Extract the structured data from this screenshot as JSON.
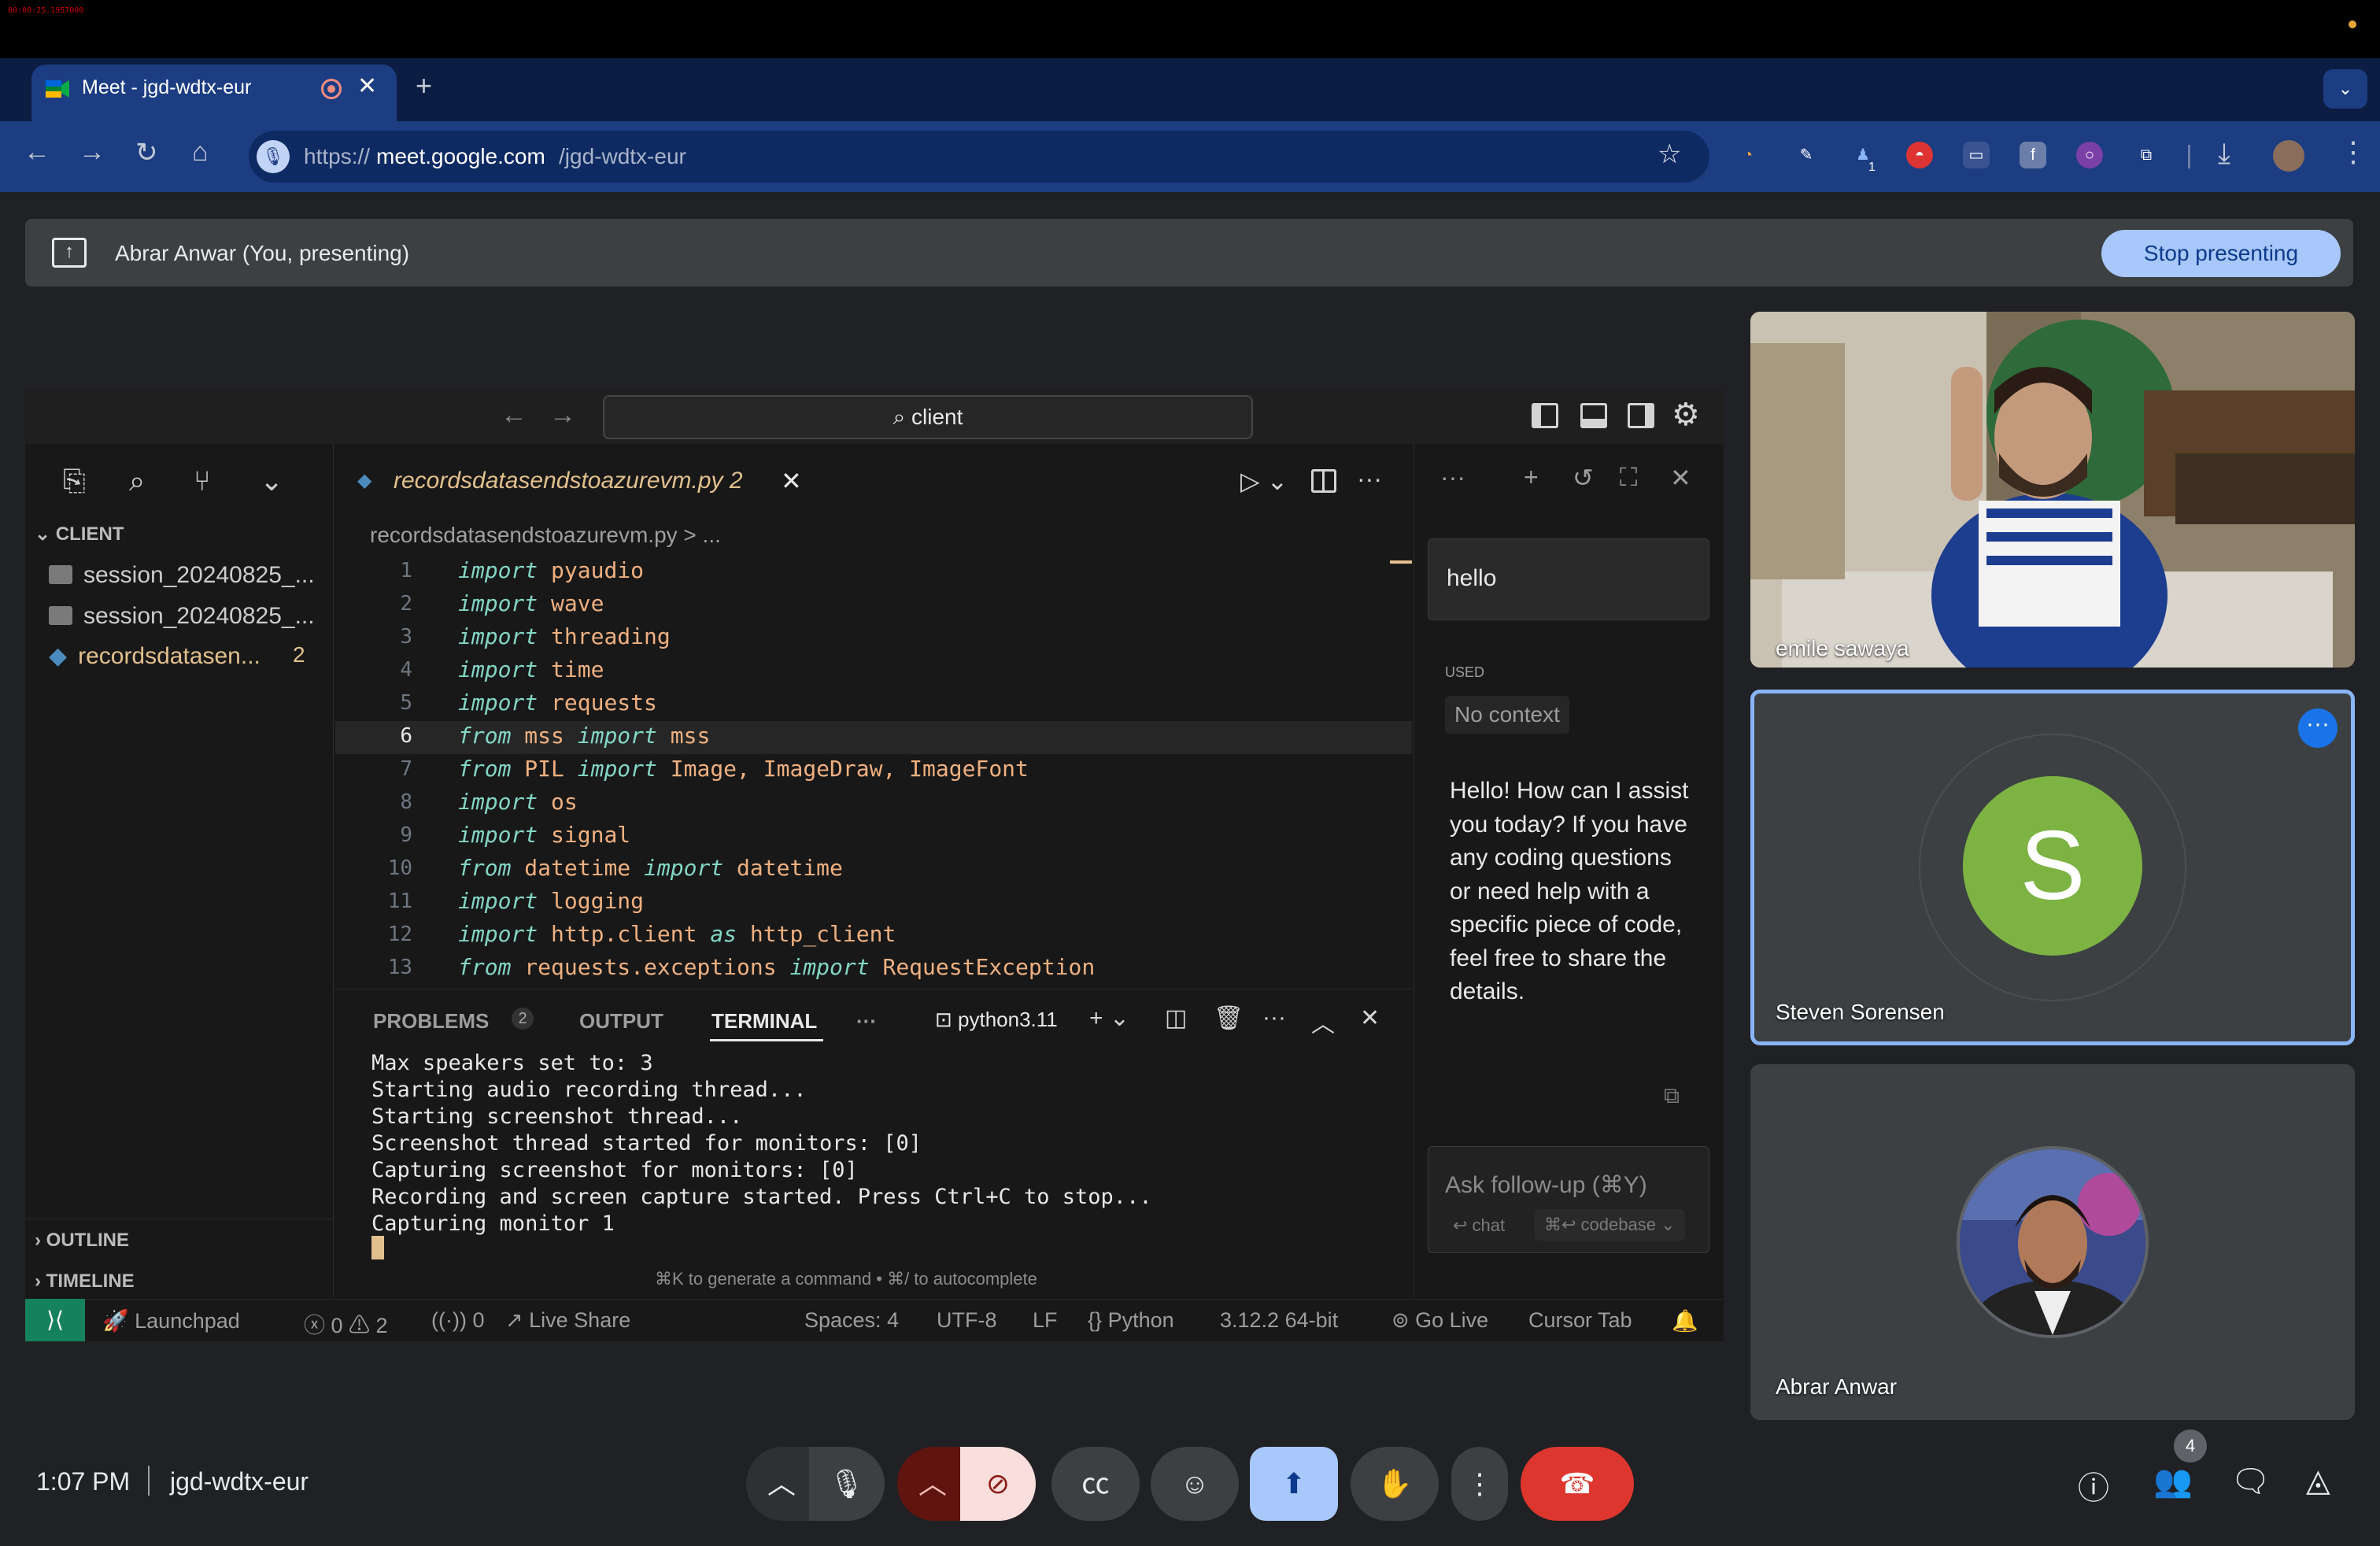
{
  "recording_indicator": "00:00:25.1957000",
  "browser": {
    "tab_title": "Meet - jgd-wdtx-eur",
    "tab_close": "✕",
    "new_tab": "+",
    "tab_menu": "⌄",
    "url_prefix": "https://",
    "url_host": "meet.google.com",
    "url_path": "/jgd-wdtx-eur",
    "extension_badge": "1"
  },
  "presenting_bar": {
    "text": "Abrar Anwar (You, presenting)",
    "stop_label": "Stop presenting"
  },
  "vscode": {
    "search": "client",
    "explorer_title": "CLIENT",
    "tree": [
      {
        "label": "session_20240825_..."
      },
      {
        "label": "session_20240825_..."
      },
      {
        "label": "recordsdatasen...",
        "badge": "2"
      }
    ],
    "outline_label": "OUTLINE",
    "timeline_label": "TIMELINE",
    "tab_label": "recordsdatasendstoazurevm.py  2",
    "breadcrumb": "recordsdatasendstoazurevm.py > ...",
    "code_lines": [
      {
        "n": "1",
        "kw": "import",
        "mod": "pyaudio"
      },
      {
        "n": "2",
        "kw": "import",
        "mod": "wave"
      },
      {
        "n": "3",
        "kw": "import",
        "mod": "threading"
      },
      {
        "n": "4",
        "kw": "import",
        "mod": "time"
      },
      {
        "n": "5",
        "kw": "import",
        "mod": "requests"
      },
      {
        "n": "6",
        "kw": "from",
        "mod": "mss",
        "kw2": "import",
        "names": "mss"
      },
      {
        "n": "7",
        "kw": "from",
        "mod": "PIL",
        "kw2": "import",
        "names": "Image, ImageDraw, ImageFont"
      },
      {
        "n": "8",
        "kw": "import",
        "mod": "os"
      },
      {
        "n": "9",
        "kw": "import",
        "mod": "signal"
      },
      {
        "n": "10",
        "kw": "from",
        "mod": "datetime",
        "kw2": "import",
        "names": "datetime"
      },
      {
        "n": "11",
        "kw": "import",
        "mod": "logging"
      },
      {
        "n": "12",
        "kw": "import",
        "mod": "http.client",
        "kw2": "as",
        "names": "http_client"
      },
      {
        "n": "13",
        "kw": "from",
        "mod": "requests.exceptions",
        "kw2": "import",
        "names": "RequestException"
      }
    ],
    "panel_tabs": {
      "problems": "PROBLEMS",
      "problems_count": "2",
      "output": "OUTPUT",
      "terminal": "TERMINAL",
      "more": "···"
    },
    "shell": "python3.11",
    "terminal_lines": [
      "Max speakers set to: 3",
      "Starting audio recording thread...",
      "Starting screenshot thread...",
      "Screenshot thread started for monitors: [0]",
      "Capturing screenshot for monitors: [0]",
      "Recording and screen capture started. Press Ctrl+C to stop...",
      "Capturing monitor 1"
    ],
    "terminal_hint": "⌘K to generate a command • ⌘/ to autocomplete",
    "ai": {
      "message": "hello",
      "used_label": "USED",
      "context": "No context",
      "reply": "Hello! How can I assist you today? If you have any coding questions or need help with a specific piece of code, feel free to share the details.",
      "followup_placeholder": "Ask follow-up (⌘Y)",
      "chat_label": "↩ chat",
      "codebase_label": "⌘↩ codebase ⌄"
    },
    "status": {
      "launchpad": "Launchpad",
      "errors": "ⓧ 0 ⚠ 2",
      "ports": "0",
      "live_share": "Live Share",
      "spaces": "Spaces: 4",
      "encoding": "UTF-8",
      "eol": "LF",
      "language": "Python",
      "interpreter": "3.12.2 64-bit",
      "go_live": "Go Live",
      "cursor_tab": "Cursor Tab"
    }
  },
  "participants": [
    {
      "name": "emile sawaya"
    },
    {
      "name": "Steven Sorensen",
      "initial": "S"
    },
    {
      "name": "Abrar Anwar"
    }
  ],
  "meeting": {
    "time": "1:07 PM",
    "code": "jgd-wdtx-eur",
    "people_count": "4"
  },
  "colors": {
    "accent_blue": "#a8c7fa",
    "end_call_red": "#dc362e",
    "avatar_green": "#7cb342",
    "vscode_bg": "#181818",
    "chrome_toolbar": "#1c3d82"
  }
}
